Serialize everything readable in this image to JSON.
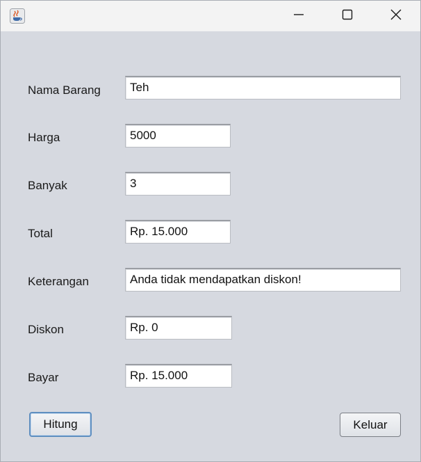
{
  "window": {
    "icon": "java-coffee-cup-icon",
    "controls": {
      "minimize_icon": "minimize-icon",
      "maximize_icon": "maximize-icon",
      "close_icon": "close-icon"
    }
  },
  "form": {
    "nama_barang": {
      "label": "Nama Barang",
      "value": "Teh"
    },
    "harga": {
      "label": "Harga",
      "value": "5000"
    },
    "banyak": {
      "label": "Banyak",
      "value": "3"
    },
    "total": {
      "label": "Total",
      "value": "Rp. 15.000"
    },
    "keterangan": {
      "label": "Keterangan",
      "value": "Anda tidak mendapatkan diskon!"
    },
    "diskon": {
      "label": "Diskon",
      "value": "Rp. 0"
    },
    "bayar": {
      "label": "Bayar",
      "value": "Rp. 15.000"
    }
  },
  "buttons": {
    "hitung": "Hitung",
    "keluar": "Keluar"
  },
  "colors": {
    "window_bg": "#d6d9e0",
    "titlebar_bg": "#f3f3f3",
    "focus_border": "#5f8fc0"
  }
}
